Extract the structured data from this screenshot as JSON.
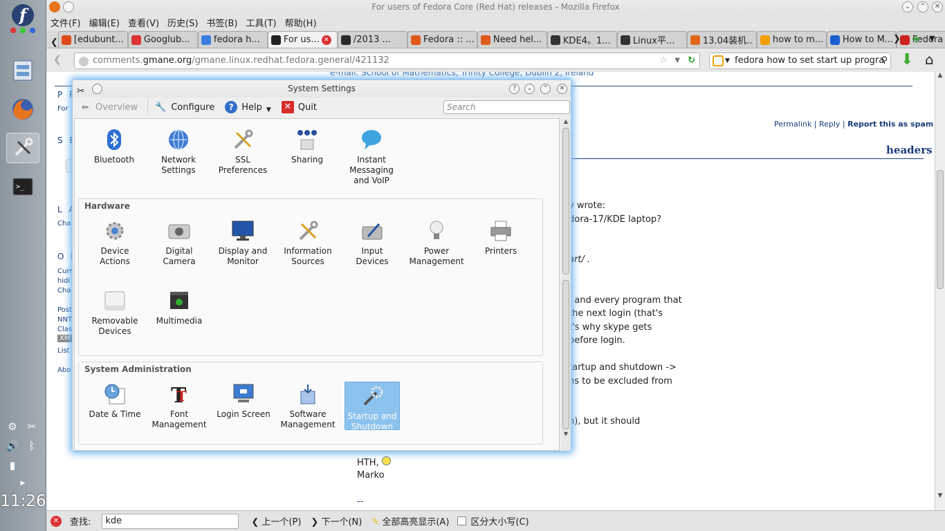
{
  "panel": {
    "clock": "11:26"
  },
  "window": {
    "title": "For users of Fedora Core (Red Hat) releases - Mozilla Firefox"
  },
  "menu": [
    "文件(F)",
    "编辑(E)",
    "查看(V)",
    "历史(S)",
    "书签(B)",
    "工具(T)",
    "帮助(H)"
  ],
  "tabs": [
    {
      "label": "[edubunt...",
      "color": "#e04a1a"
    },
    {
      "label": "Googlub...",
      "color": "#d33"
    },
    {
      "label": "fedora h...",
      "color": "#3b7de0"
    },
    {
      "label": "For us...",
      "color": "#222"
    },
    {
      "label": "/2013 ...",
      "color": "#2a2a2a"
    },
    {
      "label": "Fedora :: ...",
      "color": "#e05a1a"
    },
    {
      "label": "Need hel...",
      "color": "#e05a1a"
    },
    {
      "label": "KDE4。1...",
      "color": "#333"
    },
    {
      "label": "Linux平...",
      "color": "#333"
    },
    {
      "label": "13.04装机...",
      "color": "#e0661a"
    },
    {
      "label": "how to m...",
      "color": "#f0a000"
    },
    {
      "label": "How to M...",
      "color": "#1a5fd0"
    },
    {
      "label": "Fedora : ...",
      "color": "#c22"
    }
  ],
  "nav": {
    "url_prefix": "comments.",
    "url_domain": "gmane.org",
    "url_path": "/gmane.linux.redhat.fedora.general/421132",
    "search": "fedora how to set start up progra"
  },
  "page": {
    "top_line": "e-mail: School of Mathematics, Trinity College, Dublin 2, Ireland",
    "permalink": "Permalink",
    "reply": "Reply",
    "spam": "Report this as spam",
    "headers": "headers",
    "lines": [
      "y wrote:",
      "dora-17/KDE laptop?",
      "art/ .",
      ", and every program that",
      "the next login (that's",
      "t's why skype gets",
      "before login.",
      "tartup and shutdown ->",
      "ns to be excluded from",
      "n), but it should"
    ],
    "hth": "HTH,",
    "sig": "Marko",
    "sep": "--",
    "left_headings": [
      "P R",
      "S E",
      "L A",
      "O P"
    ],
    "left_small": [
      "For",
      "Cha",
      "Curr",
      "hidi",
      "Cha",
      "Post",
      "NNT",
      "Clas",
      "XM",
      "List",
      "Abo"
    ]
  },
  "dialog": {
    "title": "System Settings",
    "toolbar": {
      "overview": "Overview",
      "configure": "Configure",
      "help": "Help",
      "quit": "Quit",
      "search_placeholder": "Search"
    },
    "top_modules": [
      "Bluetooth",
      "Network Settings",
      "SSL Preferences",
      "Sharing",
      "Instant Messaging and VoIP"
    ],
    "hardware": {
      "label": "Hardware",
      "modules": [
        "Device Actions",
        "Digital Camera",
        "Display and Monitor",
        "Information Sources",
        "Input Devices",
        "Power Management",
        "Printers",
        "Removable Devices",
        "Multimedia"
      ]
    },
    "sysadmin": {
      "label": "System Administration",
      "modules": [
        "Date & Time",
        "Font Management",
        "Login Screen",
        "Software Management",
        "Startup and Shutdown"
      ],
      "selected": "Startup and Shutdown"
    }
  },
  "findbar": {
    "label": "查找:",
    "value": "kde",
    "prev": "上一个(P)",
    "next": "下一个(N)",
    "highlight": "全部高亮显示(A)",
    "matchcase": "区分大小写(C)"
  },
  "colors": {
    "accent": "#8cc3ee",
    "glow": "#5aaaf0",
    "link": "#1a3d7a"
  }
}
